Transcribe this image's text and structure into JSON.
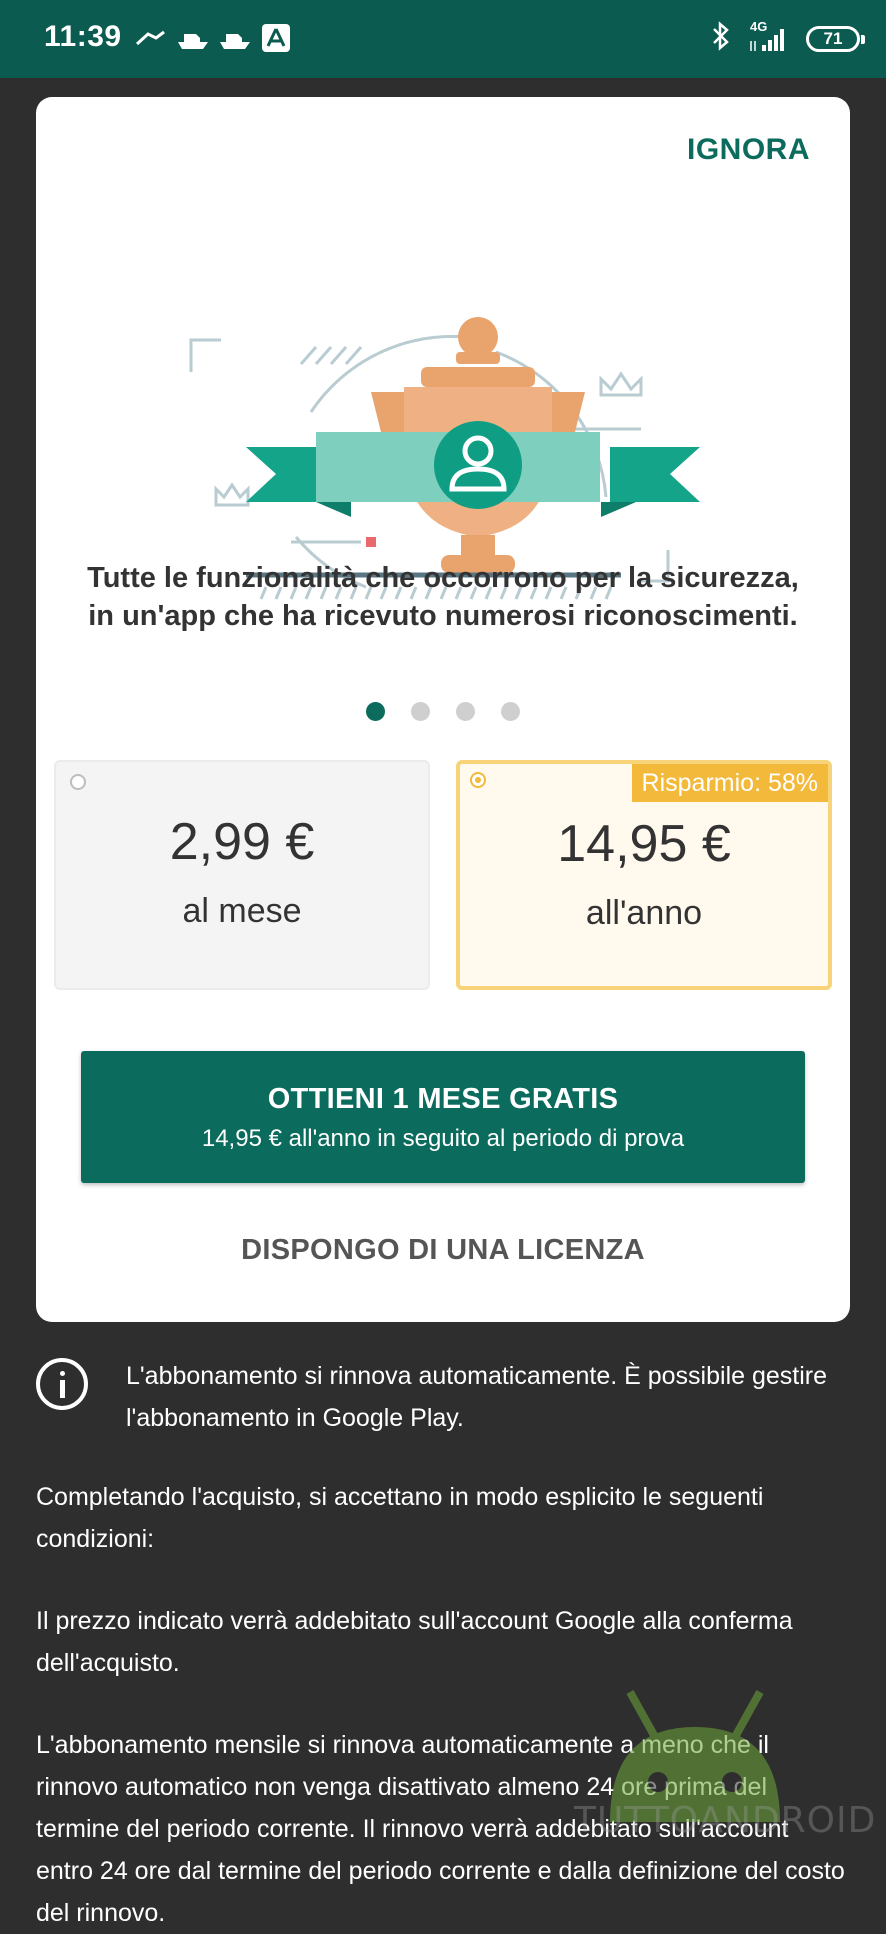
{
  "status_bar": {
    "time": "11:39",
    "network": "4G",
    "battery": "71"
  },
  "card": {
    "ignore_label": "IGNORA",
    "headline": "Tutte le funzionalità che occorrono per la sicurezza, in un'app che ha ricevuto numerosi riconoscimenti.",
    "pager": {
      "total": 4,
      "active": 1
    },
    "plans": [
      {
        "price": "2,99 €",
        "period": "al mese",
        "selected": false
      },
      {
        "price": "14,95 €",
        "period": "all'anno",
        "selected": true,
        "badge": "Risparmio: 58%"
      }
    ],
    "cta": {
      "title": "OTTIENI 1 MESE GRATIS",
      "subtitle": "14,95 € all'anno in seguito al periodo di prova"
    },
    "license_label": "DISPONGO DI UNA LICENZA"
  },
  "info_text": "L'abbonamento si rinnova automaticamente. È possibile gestire l'abbonamento in Google Play.",
  "paragraphs": [
    "Completando l'acquisto, si accettano in modo esplicito le seguenti condizioni:",
    "Il prezzo indicato verrà addebitato sull'account Google alla conferma dell'acquisto.",
    "L'abbonamento mensile si rinnova automaticamente a meno che il rinnovo automatico non venga disattivato almeno 24 ore prima del termine del periodo corrente. Il rinnovo verrà addebitato sull'account entro 24 ore dal termine del periodo corrente e dalla definizione del costo del rinnovo."
  ],
  "watermark": "TUTTOANDROID",
  "colors": {
    "brand": "#0b6b5d",
    "status_bar": "#0b5b50",
    "accent": "#f2b93b",
    "background": "#2e2e2e"
  },
  "icons": [
    "bluetooth-icon",
    "signal-icon",
    "battery-icon",
    "info-icon",
    "trophy-illustration"
  ]
}
